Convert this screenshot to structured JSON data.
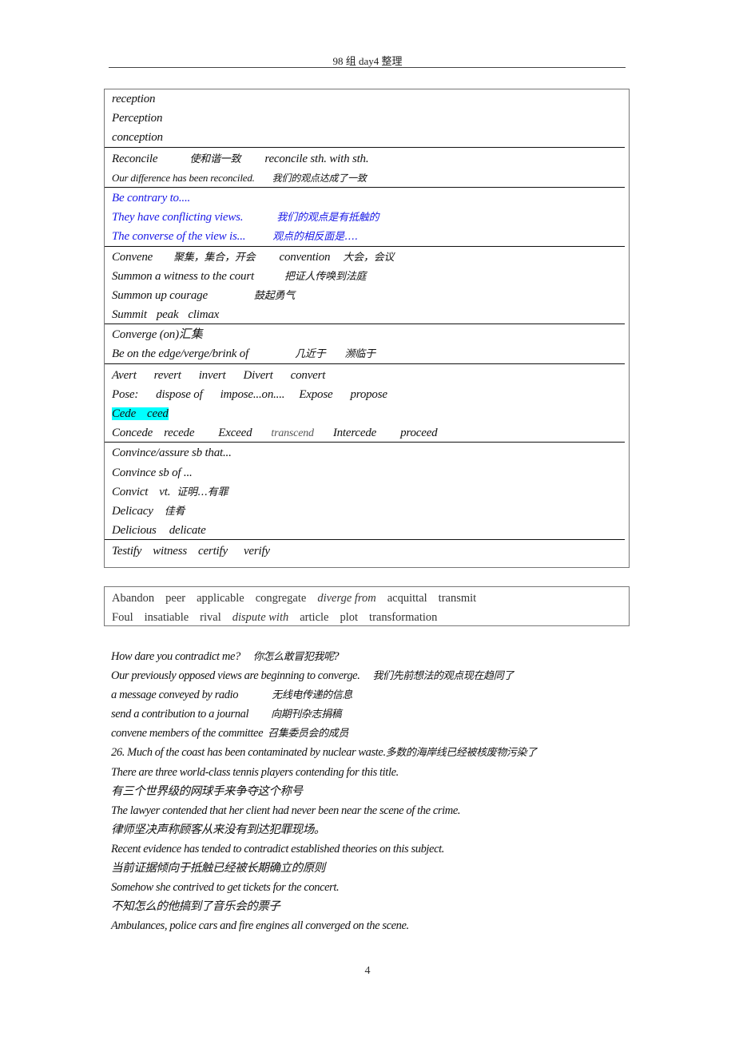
{
  "header": {
    "title": "98 组 day4 整理"
  },
  "box1": {
    "sections": [
      {
        "lines": [
          [
            "reception"
          ],
          [
            "Perception"
          ],
          [
            "conception"
          ]
        ]
      },
      {
        "lines": [
          [
            "Reconcile",
            "使和谐一致",
            "reconcile sth. with sth."
          ],
          [
            "Our difference has been reconciled.",
            "我们的观点达成了一致"
          ]
        ]
      },
      {
        "color": "#1a1ae6",
        "lines": [
          [
            "Be contrary to...."
          ],
          [
            "They have conflicting views.",
            "我们的观点是有抵触的"
          ],
          [
            "The converse of the view is...",
            "观点的相反面是…."
          ]
        ]
      },
      {
        "lines": [
          [
            "Convene",
            "聚集，集合，开会",
            "convention",
            "大会，会议"
          ],
          [
            "Summon a witness to the court",
            "把证人传唤到法庭"
          ],
          [
            "Summon up courage",
            "鼓起勇气"
          ],
          [
            "Summit",
            "peak",
            "climax"
          ]
        ]
      },
      {
        "lines": [
          [
            "Converge (on)汇集"
          ],
          [
            "Be on the edge/verge/brink of",
            "几近于",
            "濒临于"
          ]
        ]
      },
      {
        "lines": [
          [
            "Avert",
            "revert",
            "invert",
            "Divert",
            "convert"
          ],
          [
            "Pose:",
            "dispose of",
            "impose...on....",
            "Expose",
            "propose"
          ],
          [
            "Cede",
            "ceed"
          ],
          [
            "Concede",
            "recede",
            "Exceed",
            "transcend",
            "Intercede",
            "proceed"
          ]
        ],
        "highlight_color": "#00ffff"
      },
      {
        "lines": [
          [
            "Convince/assure sb that..."
          ],
          [
            "Convince sb of ..."
          ],
          [
            "Convict",
            "vt.",
            "证明…有罪"
          ],
          [
            "Delicacy",
            "佳肴"
          ],
          [
            "Delicious",
            "delicate"
          ]
        ]
      },
      {
        "lines": [
          [
            "Testify",
            "witness",
            "certify",
            "verify"
          ]
        ]
      }
    ]
  },
  "box2": {
    "row1": [
      "Abandon",
      "peer",
      "applicable",
      "congregate",
      "diverge from",
      "acquittal",
      "transmit"
    ],
    "row2": [
      "Foul",
      "insatiable",
      "rival",
      "dispute with",
      "article",
      "plot",
      "transformation"
    ]
  },
  "sentences": [
    [
      "How dare you contradict me?",
      "你怎么敢冒犯我呢?"
    ],
    [
      "Our previously opposed views are beginning to converge.",
      "我们先前想法的观点现在趋同了"
    ],
    [
      "a message conveyed by radio",
      "无线电传递的信息"
    ],
    [
      "send a contribution to a journal",
      "向期刊杂志捐稿"
    ],
    [
      "convene members of the committee",
      "召集委员会的成员"
    ],
    [
      "26. Much of the coast has been contaminated by nuclear waste.",
      "多数的海岸线已经被核废物污染了"
    ],
    [
      "There are three world-class tennis players contending for this title."
    ],
    [
      "有三个世界级的网球手来争夺这个称号"
    ],
    [
      "The lawyer contended that her client had never been near the scene of the crime."
    ],
    [
      "律师坚决声称顾客从来没有到达犯罪现场。"
    ],
    [
      "Recent evidence has tended to contradict established theories on this subject."
    ],
    [
      "当前证据倾向于抵触已经被长期确立的原则"
    ],
    [
      "Somehow she contrived to get tickets for the concert."
    ],
    [
      "不知怎么的他搞到了音乐会的票子"
    ],
    [
      "Ambulances, police cars and fire engines all converged on the scene."
    ]
  ],
  "footer": {
    "page_number": "4"
  }
}
